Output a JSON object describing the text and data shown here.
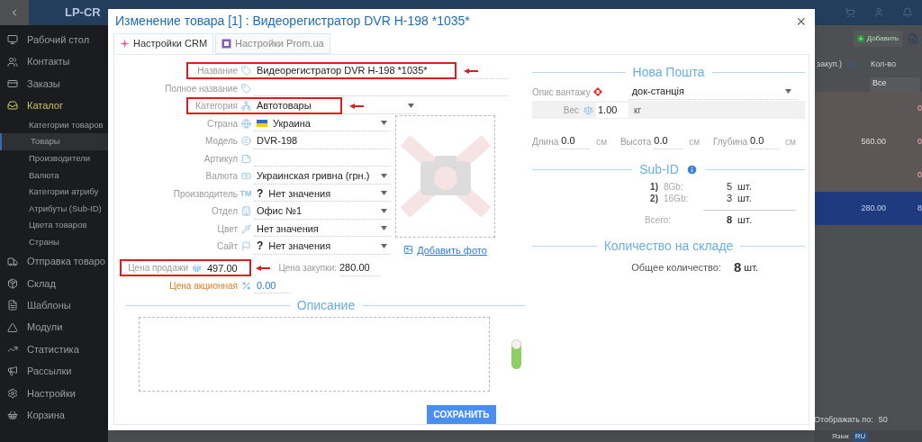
{
  "app": {
    "logo": "LP-CR",
    "sidebar": [
      {
        "label": "Рабочий стол",
        "selected": false
      },
      {
        "label": "Контакты",
        "selected": false
      },
      {
        "label": "Заказы",
        "selected": false
      },
      {
        "label": "Каталог",
        "selected": true,
        "children": [
          {
            "label": "Категории товаров",
            "selected": false
          },
          {
            "label": "Товары",
            "selected": true
          },
          {
            "label": "Производители",
            "selected": false
          },
          {
            "label": "Валюта",
            "selected": false
          },
          {
            "label": "Категории атрибу",
            "selected": false
          },
          {
            "label": "Атрибуты (Sub-ID)",
            "selected": false
          },
          {
            "label": "Цвета товаров",
            "selected": false
          },
          {
            "label": "Страны",
            "selected": false
          }
        ]
      },
      {
        "label": "Отправка товаро",
        "selected": false
      },
      {
        "label": "Склад",
        "selected": false
      },
      {
        "label": "Шаблоны",
        "selected": false
      },
      {
        "label": "Модули",
        "selected": false
      },
      {
        "label": "Статистика",
        "selected": false
      },
      {
        "label": "Рассылки",
        "selected": false
      },
      {
        "label": "Настройки",
        "selected": false
      },
      {
        "label": "Корзина",
        "selected": false
      }
    ],
    "add_button": "Добавить",
    "columns": [
      "закуп.)",
      "Кол-во"
    ],
    "filter": "Все",
    "rows": [
      {
        "qty": "0",
        "selected": false
      },
      {
        "price": "560.00",
        "qty": "0",
        "selected": false
      },
      {
        "qty": "0",
        "selected": false
      },
      {
        "price": "280.00",
        "qty": "8",
        "selected": true
      }
    ],
    "per_page_label": "Отображать по:",
    "per_page": "50",
    "language_label": "Язык",
    "language": "RU"
  },
  "modal": {
    "title": "Изменение товара [1] : Видеорегистратор DVR H-198 *1035*",
    "close": "×",
    "tabs": [
      {
        "label": "Настройки CRM",
        "selected": true
      },
      {
        "label": "Настройки Prom.ua",
        "selected": false
      }
    ],
    "fields": [
      {
        "kind": "text",
        "label": "Название",
        "value": "Видеорегистратор  DVR  H-198  *1035*",
        "highlighted": true
      },
      {
        "kind": "text",
        "label": "Полное название",
        "highlighted": false
      },
      {
        "kind": "select",
        "label": "Категория",
        "value": "Автотовары",
        "highlighted": true
      },
      {
        "kind": "flag-select",
        "label": "Страна",
        "value": "Украина",
        "highlighted": false
      },
      {
        "kind": "text",
        "label": "Модель",
        "value": "DVR-198",
        "highlighted": false
      },
      {
        "kind": "text",
        "label": "Артикул",
        "highlighted": false
      },
      {
        "kind": "select",
        "label": "Валюта",
        "value": "Украинская гривна (грн.)",
        "highlighted": false
      },
      {
        "kind": "select",
        "label": "Производитель",
        "icon_text": "TM",
        "prefix": "?",
        "value": "Нет значения",
        "highlighted": false
      },
      {
        "kind": "select",
        "label": "Отдел",
        "value": "Офис №1",
        "highlighted": false
      },
      {
        "kind": "select",
        "label": "Цвет",
        "value": "Нет значения",
        "highlighted": false
      },
      {
        "kind": "select",
        "label": "Сайт",
        "prefix": "?",
        "value": "Нет значения",
        "highlighted": false
      }
    ],
    "photo_link": "Добавить фото",
    "sale_price": {
      "label": "Цена продажи",
      "value": "497.00",
      "highlighted": true
    },
    "purchase_price": {
      "label": "Цена закупки:",
      "value": "280.00"
    },
    "promo_price": {
      "label": "Цена акционная",
      "value": "0.00"
    },
    "description": {
      "legend": "Описание",
      "toggle_on": true
    },
    "save": "СОХРАНИТЬ",
    "nova_poshta": {
      "legend": "Нова Пошта",
      "cargo_label": "Опис вантажу",
      "cargo": "док-станція",
      "weight_label": "Вес",
      "weight": "1.00",
      "weight_unit": "кг",
      "dims": [
        {
          "label": "Длина",
          "value": "0.0",
          "unit": "см"
        },
        {
          "label": "Высота",
          "value": "0.0",
          "unit": "см"
        },
        {
          "label": "Глубина",
          "value": "0.0",
          "unit": "см"
        }
      ]
    },
    "sub_id": {
      "legend": "Sub-ID",
      "items": [
        {
          "index": "1)",
          "name": "8Gb:",
          "qty": "5",
          "unit": "шт."
        },
        {
          "index": "2)",
          "name": "16Gb:",
          "qty": "3",
          "unit": "шт."
        }
      ],
      "total_label": "Всего:",
      "total": "8",
      "total_unit": "шт."
    },
    "stock": {
      "legend": "Количество на складе",
      "label": "Общее количество:",
      "value": "8",
      "unit": "шт."
    }
  }
}
